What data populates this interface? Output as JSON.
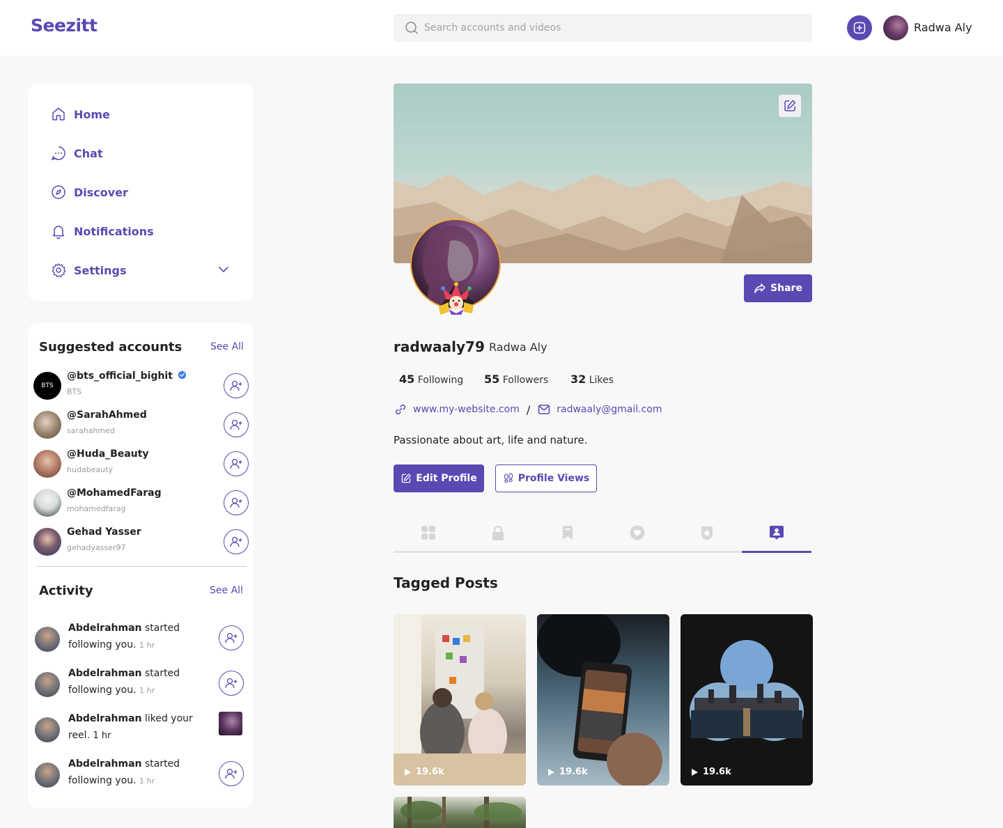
{
  "app": {
    "logo": "Seezitt"
  },
  "header": {
    "search_placeholder": "Search accounts and videos",
    "user_name": "Radwa Aly"
  },
  "nav": {
    "items": [
      {
        "label": "Home",
        "icon": "home-icon"
      },
      {
        "label": "Chat",
        "icon": "chat-icon"
      },
      {
        "label": "Discover",
        "icon": "compass-icon"
      },
      {
        "label": "Notifications",
        "icon": "bell-icon"
      },
      {
        "label": "Settings",
        "icon": "gear-icon"
      }
    ]
  },
  "suggested": {
    "title": "Suggested accounts",
    "see_all": "See All",
    "accounts": [
      {
        "handle": "@bts_official_bighit",
        "sub": "BTS",
        "verified": true,
        "avatar_text": "BTS"
      },
      {
        "handle": "@SarahAhmed",
        "sub": "sarahahmed"
      },
      {
        "handle": "@Huda_Beauty",
        "sub": "hudabeauty"
      },
      {
        "handle": "@MohamedFarag",
        "sub": "mohamedfarag"
      },
      {
        "handle": "Gehad Yasser",
        "sub": "gehadyasser97"
      }
    ]
  },
  "activity": {
    "title": "Activity",
    "see_all": "See All",
    "items": [
      {
        "name": "Abdelrahman",
        "text": "started following you.",
        "time": "1 hr"
      },
      {
        "name": "Abdelrahman",
        "text": "started following you.",
        "time": "1 hr"
      },
      {
        "name": "Abdelrahman",
        "text": "liked your reel.",
        "time": "1 hr"
      },
      {
        "name": "Abdelrahman",
        "text": "started following you.",
        "time": "1 hr"
      }
    ]
  },
  "profile": {
    "username": "radwaaly79",
    "name": "Radwa Aly",
    "stats": [
      {
        "value": "45",
        "label": "Following"
      },
      {
        "value": "55",
        "label": "Followers"
      },
      {
        "value": "32",
        "label": "Likes"
      }
    ],
    "website": "www.my-website.com",
    "separator": "/",
    "email": "radwaaly@gmail.com",
    "bio": "Passionate about art, life and nature.",
    "share_label": "Share",
    "edit_label": "Edit Profile",
    "views_label": "Profile Views"
  },
  "tabs": [
    {
      "icon": "grid-icon",
      "active": false
    },
    {
      "icon": "lock-icon",
      "active": false
    },
    {
      "icon": "bookmark-icon",
      "active": false
    },
    {
      "icon": "heart-icon",
      "active": false
    },
    {
      "icon": "badge-star-icon",
      "active": false
    },
    {
      "icon": "tagged-user-icon",
      "active": true
    }
  ],
  "tagged": {
    "title": "Tagged Posts",
    "posts": [
      {
        "count": "19.6k"
      },
      {
        "count": "19.6k"
      },
      {
        "count": "19.6k"
      }
    ]
  },
  "colors": {
    "accent": "#5a49b3",
    "badge_ring": "#f0a640"
  }
}
